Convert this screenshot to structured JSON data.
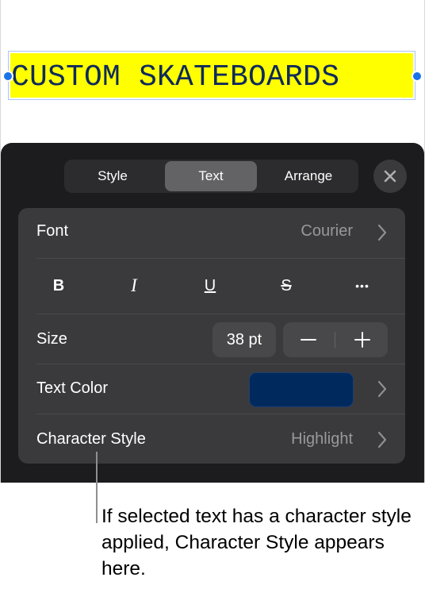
{
  "canvas": {
    "title_text": "CUSTOM SKATEBOARDS",
    "highlight_color": "#ffff00",
    "text_color": "#0f2a5a"
  },
  "popover": {
    "tabs": [
      {
        "label": "Style",
        "selected": false
      },
      {
        "label": "Text",
        "selected": true
      },
      {
        "label": "Arrange",
        "selected": false
      }
    ],
    "close_icon": "close-x-icon",
    "font": {
      "label": "Font",
      "value": "Courier"
    },
    "format_buttons": [
      {
        "glyph": "B",
        "name": "bold"
      },
      {
        "glyph": "I",
        "name": "italic"
      },
      {
        "glyph": "U",
        "name": "underline"
      },
      {
        "glyph": "S",
        "name": "strikethrough"
      },
      {
        "glyph": "•••",
        "name": "more"
      }
    ],
    "size": {
      "label": "Size",
      "value": "38 pt",
      "decrement": "−",
      "increment": "+"
    },
    "text_color": {
      "label": "Text Color",
      "swatch": "#002a5e"
    },
    "character_style": {
      "label": "Character Style",
      "value": "Highlight"
    }
  },
  "callout": {
    "text": "If selected text has a character style applied, Character Style appears here."
  }
}
